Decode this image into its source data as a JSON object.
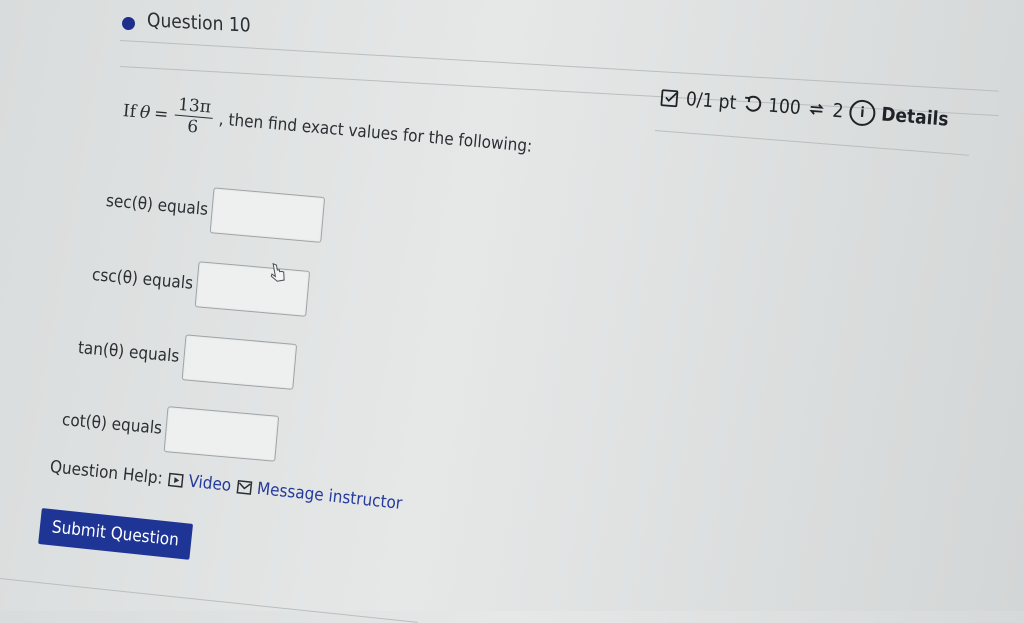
{
  "question": {
    "title": "Question 10",
    "prompt_before": "If",
    "theta_symbol": "θ",
    "equals_sign": "=",
    "fraction_numerator": "13π",
    "fraction_denominator": "6",
    "prompt_after": ", then find exact values for the following:"
  },
  "meta": {
    "score": "0/1 pt",
    "retries": "100",
    "attempts": "2",
    "details_label": "Details"
  },
  "rows": [
    {
      "label": "sec(θ) equals",
      "value": ""
    },
    {
      "label": "csc(θ) equals",
      "value": ""
    },
    {
      "label": "tan(θ) equals",
      "value": ""
    },
    {
      "label": "cot(θ) equals",
      "value": ""
    }
  ],
  "help": {
    "label": "Question Help:",
    "video_label": "Video",
    "message_label": "Message instructor"
  },
  "submit_label": "Submit Question",
  "colors": {
    "accent": "#1f3596",
    "dot": "#1d2f8c",
    "link": "#243a9c"
  },
  "icons": [
    "score-check-icon",
    "retry-icon",
    "attempts-icon",
    "info-icon",
    "video-icon",
    "message-icon"
  ]
}
